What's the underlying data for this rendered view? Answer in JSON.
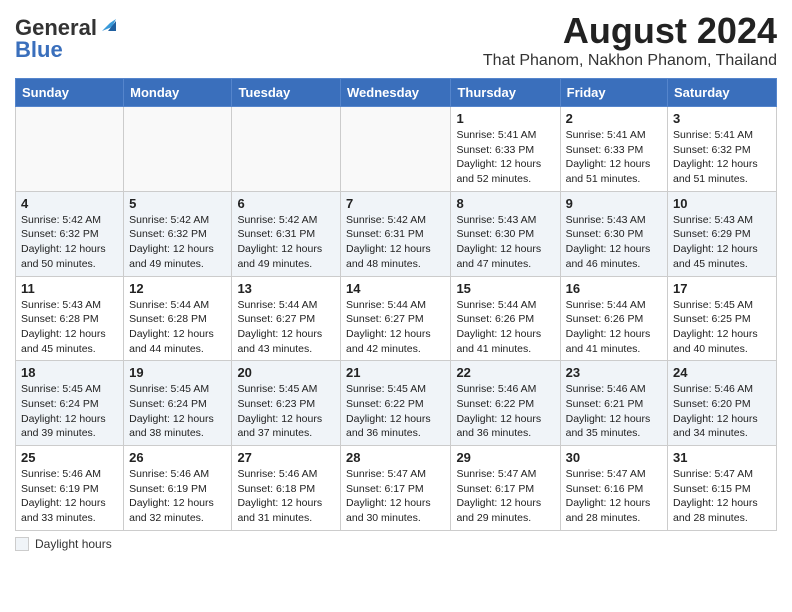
{
  "header": {
    "logo_line1": "General",
    "logo_line2": "Blue",
    "title": "August 2024",
    "subtitle": "That Phanom, Nakhon Phanom, Thailand"
  },
  "weekdays": [
    "Sunday",
    "Monday",
    "Tuesday",
    "Wednesday",
    "Thursday",
    "Friday",
    "Saturday"
  ],
  "legend_label": "Daylight hours",
  "weeks": [
    [
      {
        "day": "",
        "info": ""
      },
      {
        "day": "",
        "info": ""
      },
      {
        "day": "",
        "info": ""
      },
      {
        "day": "",
        "info": ""
      },
      {
        "day": "1",
        "info": "Sunrise: 5:41 AM\nSunset: 6:33 PM\nDaylight: 12 hours\nand 52 minutes."
      },
      {
        "day": "2",
        "info": "Sunrise: 5:41 AM\nSunset: 6:33 PM\nDaylight: 12 hours\nand 51 minutes."
      },
      {
        "day": "3",
        "info": "Sunrise: 5:41 AM\nSunset: 6:32 PM\nDaylight: 12 hours\nand 51 minutes."
      }
    ],
    [
      {
        "day": "4",
        "info": "Sunrise: 5:42 AM\nSunset: 6:32 PM\nDaylight: 12 hours\nand 50 minutes."
      },
      {
        "day": "5",
        "info": "Sunrise: 5:42 AM\nSunset: 6:32 PM\nDaylight: 12 hours\nand 49 minutes."
      },
      {
        "day": "6",
        "info": "Sunrise: 5:42 AM\nSunset: 6:31 PM\nDaylight: 12 hours\nand 49 minutes."
      },
      {
        "day": "7",
        "info": "Sunrise: 5:42 AM\nSunset: 6:31 PM\nDaylight: 12 hours\nand 48 minutes."
      },
      {
        "day": "8",
        "info": "Sunrise: 5:43 AM\nSunset: 6:30 PM\nDaylight: 12 hours\nand 47 minutes."
      },
      {
        "day": "9",
        "info": "Sunrise: 5:43 AM\nSunset: 6:30 PM\nDaylight: 12 hours\nand 46 minutes."
      },
      {
        "day": "10",
        "info": "Sunrise: 5:43 AM\nSunset: 6:29 PM\nDaylight: 12 hours\nand 45 minutes."
      }
    ],
    [
      {
        "day": "11",
        "info": "Sunrise: 5:43 AM\nSunset: 6:28 PM\nDaylight: 12 hours\nand 45 minutes."
      },
      {
        "day": "12",
        "info": "Sunrise: 5:44 AM\nSunset: 6:28 PM\nDaylight: 12 hours\nand 44 minutes."
      },
      {
        "day": "13",
        "info": "Sunrise: 5:44 AM\nSunset: 6:27 PM\nDaylight: 12 hours\nand 43 minutes."
      },
      {
        "day": "14",
        "info": "Sunrise: 5:44 AM\nSunset: 6:27 PM\nDaylight: 12 hours\nand 42 minutes."
      },
      {
        "day": "15",
        "info": "Sunrise: 5:44 AM\nSunset: 6:26 PM\nDaylight: 12 hours\nand 41 minutes."
      },
      {
        "day": "16",
        "info": "Sunrise: 5:44 AM\nSunset: 6:26 PM\nDaylight: 12 hours\nand 41 minutes."
      },
      {
        "day": "17",
        "info": "Sunrise: 5:45 AM\nSunset: 6:25 PM\nDaylight: 12 hours\nand 40 minutes."
      }
    ],
    [
      {
        "day": "18",
        "info": "Sunrise: 5:45 AM\nSunset: 6:24 PM\nDaylight: 12 hours\nand 39 minutes."
      },
      {
        "day": "19",
        "info": "Sunrise: 5:45 AM\nSunset: 6:24 PM\nDaylight: 12 hours\nand 38 minutes."
      },
      {
        "day": "20",
        "info": "Sunrise: 5:45 AM\nSunset: 6:23 PM\nDaylight: 12 hours\nand 37 minutes."
      },
      {
        "day": "21",
        "info": "Sunrise: 5:45 AM\nSunset: 6:22 PM\nDaylight: 12 hours\nand 36 minutes."
      },
      {
        "day": "22",
        "info": "Sunrise: 5:46 AM\nSunset: 6:22 PM\nDaylight: 12 hours\nand 36 minutes."
      },
      {
        "day": "23",
        "info": "Sunrise: 5:46 AM\nSunset: 6:21 PM\nDaylight: 12 hours\nand 35 minutes."
      },
      {
        "day": "24",
        "info": "Sunrise: 5:46 AM\nSunset: 6:20 PM\nDaylight: 12 hours\nand 34 minutes."
      }
    ],
    [
      {
        "day": "25",
        "info": "Sunrise: 5:46 AM\nSunset: 6:19 PM\nDaylight: 12 hours\nand 33 minutes."
      },
      {
        "day": "26",
        "info": "Sunrise: 5:46 AM\nSunset: 6:19 PM\nDaylight: 12 hours\nand 32 minutes."
      },
      {
        "day": "27",
        "info": "Sunrise: 5:46 AM\nSunset: 6:18 PM\nDaylight: 12 hours\nand 31 minutes."
      },
      {
        "day": "28",
        "info": "Sunrise: 5:47 AM\nSunset: 6:17 PM\nDaylight: 12 hours\nand 30 minutes."
      },
      {
        "day": "29",
        "info": "Sunrise: 5:47 AM\nSunset: 6:17 PM\nDaylight: 12 hours\nand 29 minutes."
      },
      {
        "day": "30",
        "info": "Sunrise: 5:47 AM\nSunset: 6:16 PM\nDaylight: 12 hours\nand 28 minutes."
      },
      {
        "day": "31",
        "info": "Sunrise: 5:47 AM\nSunset: 6:15 PM\nDaylight: 12 hours\nand 28 minutes."
      }
    ]
  ]
}
